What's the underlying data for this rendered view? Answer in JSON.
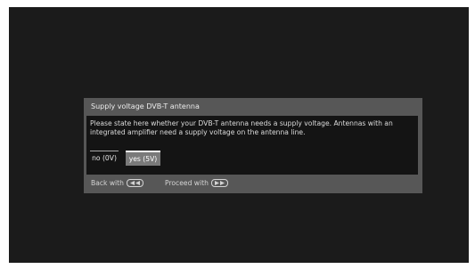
{
  "dialog": {
    "title": "Supply voltage DVB-T antenna",
    "message": "Please state here whether your DVB-T antenna needs a supply voltage. Antennas with an integrated amplifier need a supply voltage on the antenna line.",
    "options": [
      {
        "label": "no (0V)",
        "selected": false
      },
      {
        "label": "yes (5V)",
        "selected": true
      }
    ]
  },
  "footer": {
    "back_label": "Back with",
    "back_icon": "rewind-key-icon",
    "proceed_label": "Proceed with",
    "proceed_icon": "fast-forward-key-icon"
  },
  "colors": {
    "screen_background": "#1b1b1b",
    "dialog_frame": "#575757",
    "dialog_body": "#141414",
    "selected_option": "#7a7a7a"
  }
}
